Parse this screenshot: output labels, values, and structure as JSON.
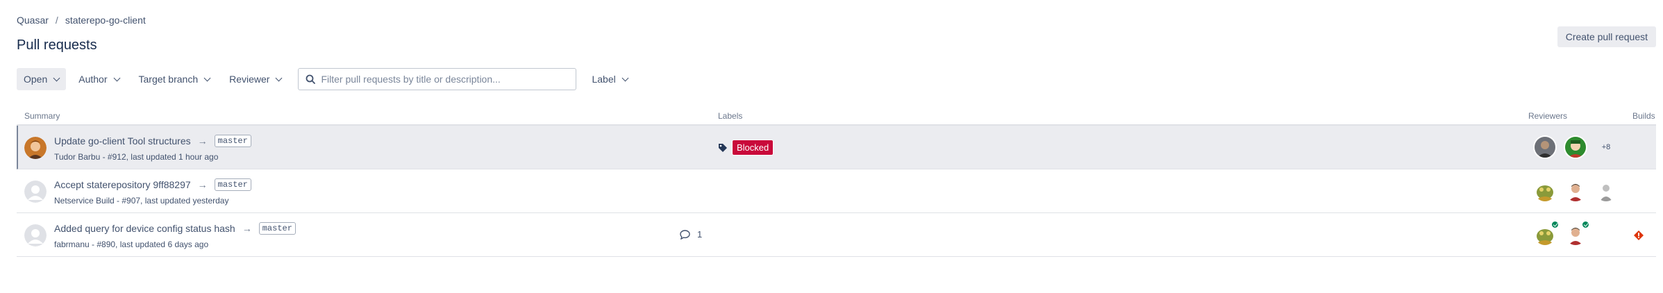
{
  "breadcrumb": {
    "project": "Quasar",
    "separator": "/",
    "repo": "staterepo-go-client"
  },
  "page_title": "Pull requests",
  "create_button": "Create pull request",
  "filters": {
    "state": "Open",
    "author": "Author",
    "target_branch": "Target branch",
    "reviewer": "Reviewer",
    "search_placeholder": "Filter pull requests by title or description...",
    "label": "Label"
  },
  "columns": {
    "summary": "Summary",
    "labels": "Labels",
    "reviewers": "Reviewers",
    "builds": "Builds"
  },
  "rows": [
    {
      "title": "Update go-client Tool structures",
      "branch": "master",
      "meta": "Tudor Barbu - #912, last updated 1 hour ago",
      "label": "Blocked",
      "reviewers_more": "+8"
    },
    {
      "title": "Accept staterepository 9ff88297",
      "branch": "master",
      "meta": "Netservice Build - #907, last updated yesterday"
    },
    {
      "title": "Added query for device config status hash",
      "branch": "master",
      "meta": "fabrmanu - #890, last updated 6 days ago",
      "comments": "1"
    }
  ],
  "colors": {
    "blocked": "#c9093a",
    "approved": "#00875a",
    "build_failed": "#de350b"
  },
  "icons": {
    "arrow": "→"
  }
}
